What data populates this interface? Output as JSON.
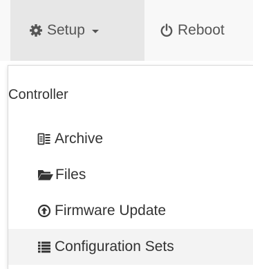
{
  "navbar": {
    "setup": {
      "label": "Setup",
      "icon": "gear-icon"
    },
    "reboot": {
      "label": "Reboot",
      "icon": "power-icon"
    }
  },
  "dropdown": {
    "header": "Controller",
    "items": [
      {
        "label": "Archive",
        "icon": "archive-icon"
      },
      {
        "label": "Files",
        "icon": "folder-open-icon"
      },
      {
        "label": "Firmware Update",
        "icon": "upload-circle-icon"
      },
      {
        "label": "Configuration Sets",
        "icon": "list-icon",
        "hovered": true
      }
    ]
  },
  "colors": {
    "navbar_bg": "#f8f8f8",
    "active_nav_bg": "#e7e7e7",
    "menu_hover_bg": "#f3f3f3",
    "text": "#333333",
    "nav_text": "#555555"
  }
}
